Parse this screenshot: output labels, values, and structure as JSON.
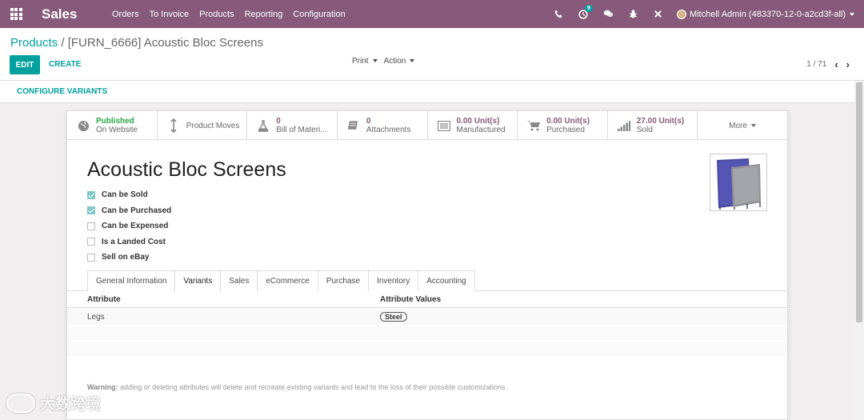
{
  "navbar": {
    "app_name": "Sales",
    "menu": [
      "Orders",
      "To Invoice",
      "Products",
      "Reporting",
      "Configuration"
    ],
    "activity_badge": "9",
    "user": "Mitchell Admin (483370-12-0-a2cd3f-all)"
  },
  "control": {
    "breadcrumb_parent": "Products",
    "breadcrumb_sep": "/",
    "breadcrumb_current": "[FURN_6666] Acoustic Bloc Screens",
    "edit_label": "EDIT",
    "create_label": "CREATE",
    "print_label": "Print",
    "action_label": "Action",
    "pager": "1 / 71"
  },
  "configure_variants": "CONFIGURE VARIANTS",
  "stat_buttons": [
    {
      "value": "Published",
      "label": "On Website"
    },
    {
      "value": "",
      "label": "Product Moves"
    },
    {
      "value": "0",
      "label": "Bill of Materi..."
    },
    {
      "value": "0",
      "label": "Attachments"
    },
    {
      "value": "0.00 Unit(s)",
      "label": "Manufactured"
    },
    {
      "value": "0.00 Unit(s)",
      "label": "Purchased"
    },
    {
      "value": "27.00 Unit(s)",
      "label": "Sold"
    },
    {
      "value": "",
      "label": "More"
    }
  ],
  "product": {
    "name": "Acoustic Bloc Screens",
    "checks": [
      {
        "label": "Can be Sold",
        "checked": true
      },
      {
        "label": "Can be Purchased",
        "checked": true
      },
      {
        "label": "Can be Expensed",
        "checked": false
      },
      {
        "label": "Is a Landed Cost",
        "checked": false
      },
      {
        "label": "Sell on eBay",
        "checked": false
      }
    ]
  },
  "tabs": [
    "General Information",
    "Variants",
    "Sales",
    "eCommerce",
    "Purchase",
    "Inventory",
    "Accounting"
  ],
  "active_tab": "Variants",
  "attributes": {
    "headers": [
      "Attribute",
      "Attribute Values"
    ],
    "rows": [
      {
        "attribute": "Legs",
        "values": [
          "Steel"
        ]
      }
    ]
  },
  "warning": {
    "label": "Warning:",
    "text": " adding or deleting attributes will delete and recreate existing variants and lead to the loss of their possible customizations."
  },
  "watermark": "大数跨境",
  "colors": {
    "brand": "#875a7b",
    "accent": "#00a09d",
    "published": "#28a745"
  }
}
